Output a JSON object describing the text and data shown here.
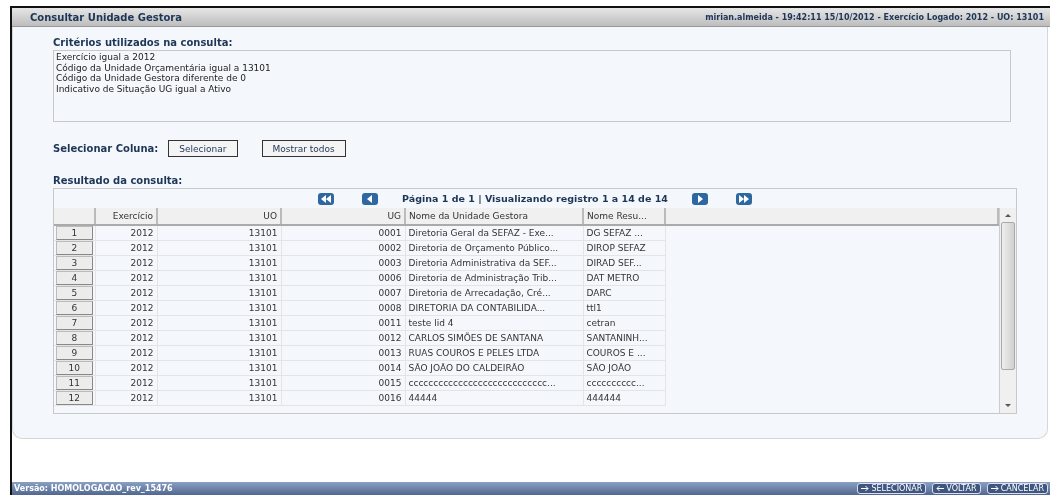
{
  "header": {
    "title": "Consultar Unidade Gestora",
    "session": "mirian.almeida - 19:42:11 15/10/2012 - Exercício Logado: 2012 - UO: 13101"
  },
  "criteria": {
    "label": "Critérios utilizados na consulta:",
    "lines": [
      "Exercício igual a 2012",
      "Código da Unidade Orçamentária igual a 13101",
      "Código da Unidade Gestora diferente de 0",
      "Indicativo de Situação UG igual a Ativo"
    ]
  },
  "column_select": {
    "label": "Selecionar Coluna:",
    "buttons": [
      "Selecionar",
      "Mostrar todos"
    ]
  },
  "results": {
    "label": "Resultado da consulta:",
    "pager": "Página 1 de 1 | Visualizando registro 1 a 14 de 14",
    "columns": [
      {
        "label": "Exercício"
      },
      {
        "label": "UO"
      },
      {
        "label": "UG"
      },
      {
        "label": "Nome da Unidade Gestora"
      },
      {
        "label": "Nome Resu..."
      }
    ],
    "rows": [
      {
        "num": "1",
        "cells": [
          "2012",
          "13101",
          "0001",
          "Diretoria Geral da SEFAZ - Exe...",
          "DG SEFAZ ..."
        ]
      },
      {
        "num": "2",
        "cells": [
          "2012",
          "13101",
          "0002",
          "Diretoria de Orçamento Público...",
          "DIROP SEFAZ"
        ]
      },
      {
        "num": "3",
        "cells": [
          "2012",
          "13101",
          "0003",
          "Diretoria Administrativa da SEF...",
          "DIRAD SEF..."
        ]
      },
      {
        "num": "4",
        "cells": [
          "2012",
          "13101",
          "0006",
          "Diretoria de Administração Trib...",
          "DAT METRO"
        ]
      },
      {
        "num": "5",
        "cells": [
          "2012",
          "13101",
          "0007",
          "Diretoria de Arrecadação, Cré...",
          "DARC"
        ]
      },
      {
        "num": "6",
        "cells": [
          "2012",
          "13101",
          "0008",
          "DIRETORIA DA CONTABILIDA...",
          "ttl1"
        ]
      },
      {
        "num": "7",
        "cells": [
          "2012",
          "13101",
          "0011",
          "teste lid 4",
          "cetran"
        ]
      },
      {
        "num": "8",
        "cells": [
          "2012",
          "13101",
          "0012",
          "CARLOS SIMÕES DE SANTANA",
          "SANTANINH..."
        ]
      },
      {
        "num": "9",
        "cells": [
          "2012",
          "13101",
          "0013",
          "RUAS COUROS E PELES LTDA",
          "COUROS E ..."
        ]
      },
      {
        "num": "10",
        "cells": [
          "2012",
          "13101",
          "0014",
          "SÃO JOÃO DO CALDEIRÃO",
          "SÃO JOÃO"
        ]
      },
      {
        "num": "11",
        "cells": [
          "2012",
          "13101",
          "0015",
          "cccccccccccccccccccccccccccc...",
          "cccccccccc..."
        ]
      },
      {
        "num": "12",
        "cells": [
          "2012",
          "13101",
          "0016",
          "44444",
          "444444"
        ]
      }
    ]
  },
  "footer": {
    "version": "Versão: HOMOLOGACAO_rev_15476",
    "buttons": [
      {
        "label": "SELECIONAR",
        "kind": "forward"
      },
      {
        "label": "VOLTAR",
        "kind": "back"
      },
      {
        "label": "CANCELAR",
        "kind": "forward"
      }
    ]
  }
}
